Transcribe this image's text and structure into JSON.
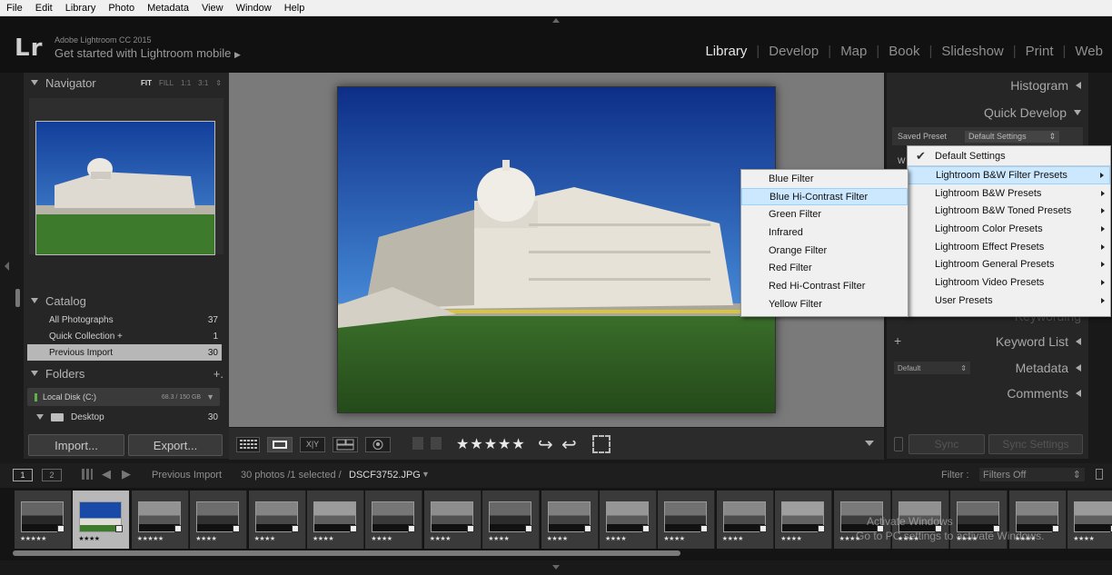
{
  "menu": [
    "File",
    "Edit",
    "Library",
    "Photo",
    "Metadata",
    "View",
    "Window",
    "Help"
  ],
  "identity": {
    "logo": "Lr",
    "product": "Adobe Lightroom CC 2015",
    "tagline": "Get started with Lightroom mobile"
  },
  "modules": [
    {
      "label": "Library",
      "active": true
    },
    {
      "label": "Develop",
      "active": false
    },
    {
      "label": "Map",
      "active": false
    },
    {
      "label": "Book",
      "active": false
    },
    {
      "label": "Slideshow",
      "active": false
    },
    {
      "label": "Print",
      "active": false
    },
    {
      "label": "Web",
      "active": false
    }
  ],
  "navigator": {
    "title": "Navigator",
    "zoom_options": [
      "FIT",
      "FILL",
      "1:1",
      "3:1"
    ],
    "active_zoom": "FIT"
  },
  "catalog": {
    "title": "Catalog",
    "items": [
      {
        "label": "All Photographs",
        "count": "37",
        "selected": false
      },
      {
        "label": "Quick Collection +",
        "count": "1",
        "selected": false
      },
      {
        "label": "Previous Import",
        "count": "30",
        "selected": true
      }
    ]
  },
  "folders": {
    "title": "Folders",
    "add": "+.",
    "disk": {
      "label": "Local Disk (C:)",
      "space": "68.3 / 150 GB"
    },
    "items": [
      {
        "label": "Desktop",
        "count": "30"
      }
    ]
  },
  "left_buttons": {
    "import": "Import...",
    "export": "Export..."
  },
  "toolbar": {
    "stars": "★★★★★"
  },
  "right_panel": {
    "histogram": "Histogram",
    "quick_develop": "Quick Develop",
    "saved_preset_label": "Saved Preset",
    "saved_preset_value": "Default Settings",
    "partial_label": "W",
    "keywording": "Keywording",
    "keyword_list": "Keyword List",
    "keyword_add": "+",
    "metadata_preset": "Default",
    "metadata": "Metadata",
    "comments": "Comments",
    "sync": "Sync",
    "sync_settings": "Sync Settings"
  },
  "preset_menu": {
    "checked": "Default Settings",
    "items": [
      {
        "label": "Lightroom B&W Filter Presets",
        "highlight": true
      },
      {
        "label": "Lightroom B&W Presets",
        "highlight": false
      },
      {
        "label": "Lightroom B&W Toned Presets",
        "highlight": false
      },
      {
        "label": "Lightroom Color Presets",
        "highlight": false
      },
      {
        "label": "Lightroom Effect Presets",
        "highlight": false
      },
      {
        "label": "Lightroom General Presets",
        "highlight": false
      },
      {
        "label": "Lightroom Video Presets",
        "highlight": false
      },
      {
        "label": "User Presets",
        "highlight": false
      }
    ]
  },
  "submenu": {
    "items": [
      {
        "label": "Blue Filter",
        "highlight": false
      },
      {
        "label": "Blue Hi-Contrast Filter",
        "highlight": true
      },
      {
        "label": "Green Filter",
        "highlight": false
      },
      {
        "label": "Infrared",
        "highlight": false
      },
      {
        "label": "Orange Filter",
        "highlight": false
      },
      {
        "label": "Red Filter",
        "highlight": false
      },
      {
        "label": "Red Hi-Contrast Filter",
        "highlight": false
      },
      {
        "label": "Yellow Filter",
        "highlight": false
      }
    ]
  },
  "filmbar": {
    "screen1": "1",
    "screen2": "2",
    "source": "Previous Import",
    "count": "30 photos /1 selected /",
    "filename": "DSCF3752.JPG",
    "filter_label": "Filter :",
    "filter_value": "Filters Off"
  },
  "filmstrip": {
    "stars": [
      "★★★★★",
      "★★★★",
      "★★★★★",
      "★★★★",
      "★★★★",
      "★★★★",
      "★★★★",
      "★★★★",
      "★★★★",
      "★★★★",
      "★★★★",
      "★★★★",
      "★★★★",
      "★★★★",
      "★★★★",
      "★★★★",
      "★★★★",
      "★★★★",
      "★★★★"
    ],
    "selected_index": 1
  },
  "watermark": {
    "line1": "Activate Windows",
    "line2": "Go to PC settings to activate Windows."
  },
  "colors": {
    "accent_highlight": "#cce8ff",
    "panel": "#262626",
    "center_bg": "#7a7a7a"
  }
}
